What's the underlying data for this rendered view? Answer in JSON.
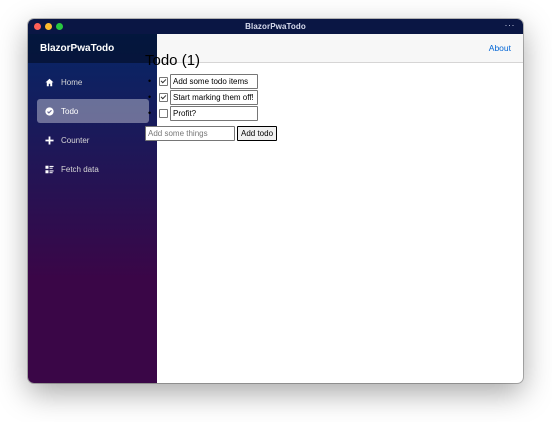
{
  "window": {
    "title": "BlazorPwaTodo",
    "menu_glyph": "···"
  },
  "brand": "BlazorPwaTodo",
  "topbar": {
    "about": "About"
  },
  "nav": {
    "home": "Home",
    "todo": "Todo",
    "counter": "Counter",
    "fetch": "Fetch data"
  },
  "page": {
    "heading": "Todo (1)",
    "items": [
      {
        "title": "Add some todo items",
        "done": true
      },
      {
        "title": "Start marking them off!",
        "done": true
      },
      {
        "title": "Profit?",
        "done": false
      }
    ],
    "new_placeholder": "Add some things",
    "add_button": "Add todo"
  },
  "colors": {
    "sidebar_top": "#052767",
    "sidebar_bottom": "#3a0647",
    "link": "#0366d6"
  }
}
